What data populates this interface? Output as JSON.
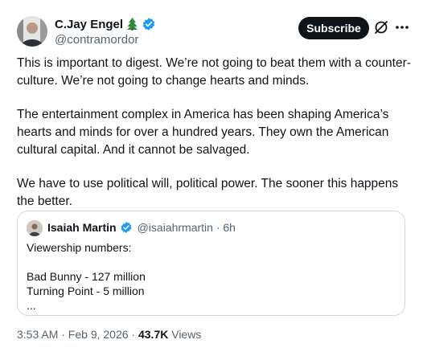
{
  "author": {
    "display_name": "C.Jay Engel",
    "handle": "@contramordor",
    "verified_color": "#1d9bf0",
    "badge_icon": "pine-tree-icon"
  },
  "actions": {
    "subscribe_label": "Subscribe",
    "grok_icon": "grok-icon",
    "more_icon": "more-dots-icon"
  },
  "post": {
    "paragraphs": [
      "This is important to digest. We’re not going to beat them with a counter-culture. We’re not going to change hearts and minds.",
      "The entertainment complex in America has been shaping America’s hearts and minds for over a hundred years. They own the American cultural capital. And it cannot be salvaged.",
      "We have to use political will, political power. The sooner this happens the better."
    ]
  },
  "quote": {
    "display_name": "Isaiah Martin",
    "handle_time": "@isaiahrmartin · 6h",
    "lines": [
      "Viewership numbers:",
      "",
      "Bad Bunny - 127 million",
      "Turning Point - 5 million",
      "..."
    ]
  },
  "meta": {
    "time_date": "3:53 AM · Feb 9, 2026 · ",
    "views_count": "43.7K",
    "views_label": " Views"
  }
}
